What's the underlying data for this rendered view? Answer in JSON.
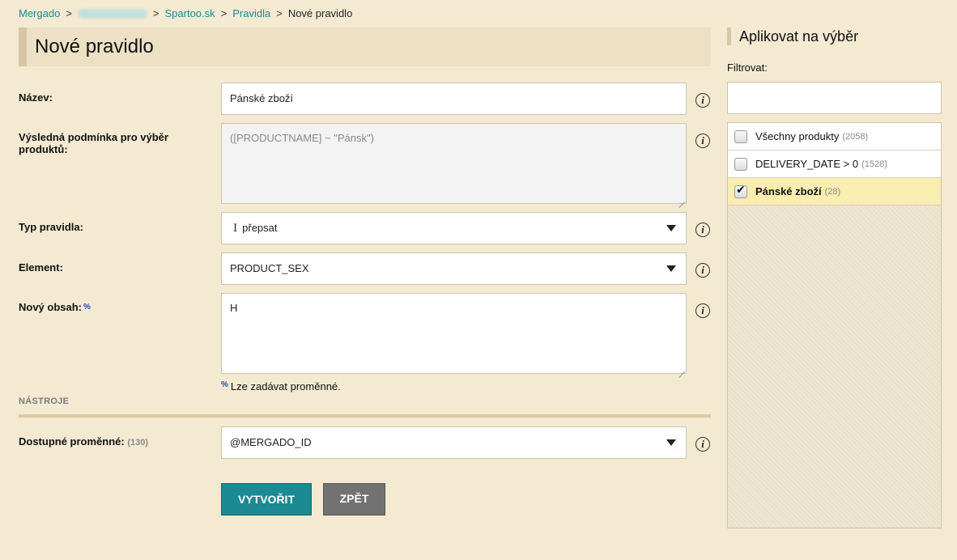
{
  "breadcrumb": {
    "items": [
      "Mergado",
      "Spartoo.sk",
      "Pravidla"
    ],
    "current": "Nové pravidlo",
    "separator": ">"
  },
  "page_title": "Nové pravidlo",
  "form": {
    "name_label": "Název:",
    "name_value": "Pánské zboží",
    "condition_label": "Výsledná podmínka pro výběr produktů:",
    "condition_value": "([PRODUCTNAME] ~ \"Pánsk\")",
    "rule_type_label": "Typ pravidla:",
    "rule_type_value": "přepsat",
    "element_label": "Element:",
    "element_value": "PRODUCT_SEX",
    "new_content_label": "Nový obsah:",
    "new_content_value": "H",
    "percent_marker": "%",
    "variables_hint": "Lze zadávat proměnné.",
    "tools_section": "NÁSTROJE",
    "variables_label": "Dostupné proměnné:",
    "variables_count": "(130)",
    "variables_value": "@MERGADO_ID",
    "info_glyph": "i"
  },
  "buttons": {
    "create": "VYTVOŘIT",
    "back": "ZPĚT"
  },
  "sidebar": {
    "title": "Aplikovat na výběr",
    "filter_label": "Filtrovat:",
    "filter_value": "",
    "items": [
      {
        "label": "Všechny produkty",
        "count": "(2058)",
        "checked": false
      },
      {
        "label": "DELIVERY_DATE > 0",
        "count": "(1528)",
        "checked": false
      },
      {
        "label": "Pánské zboží",
        "count": "(28)",
        "checked": true
      }
    ]
  },
  "colors": {
    "background": "#f4ead2",
    "link": "#1a8a94",
    "primary_button": "#1b8a93",
    "secondary_button": "#727272",
    "selected_row": "#faedb0"
  }
}
